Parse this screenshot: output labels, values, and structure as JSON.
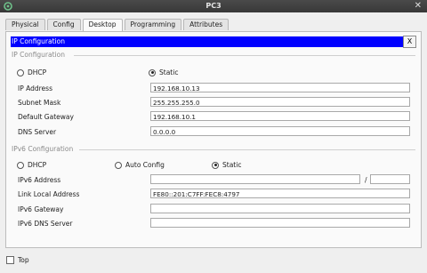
{
  "window": {
    "title": "PC3"
  },
  "tabs": [
    "Physical",
    "Config",
    "Desktop",
    "Programming",
    "Attributes"
  ],
  "active_tab": "Desktop",
  "ip_config": {
    "header": "IP Configuration",
    "close_label": "X",
    "section_label": "IP Configuration",
    "mode_options": {
      "dhcp": "DHCP",
      "static": "Static"
    },
    "selected_mode": "Static",
    "ip_address": {
      "label": "IP Address",
      "value": "192.168.10.13"
    },
    "subnet_mask": {
      "label": "Subnet Mask",
      "value": "255.255.255.0"
    },
    "default_gateway": {
      "label": "Default Gateway",
      "value": "192.168.10.1"
    },
    "dns_server": {
      "label": "DNS Server",
      "value": "0.0.0.0"
    }
  },
  "ipv6_config": {
    "section_label": "IPv6 Configuration",
    "mode_options": {
      "dhcp": "DHCP",
      "auto": "Auto Config",
      "static": "Static"
    },
    "selected_mode": "Static",
    "ipv6_address": {
      "label": "IPv6 Address",
      "value": "",
      "prefix": "",
      "separator": "/"
    },
    "link_local_address": {
      "label": "Link Local Address",
      "value": "FE80::201:C7FF:FEC8:4797"
    },
    "ipv6_gateway": {
      "label": "IPv6 Gateway",
      "value": ""
    },
    "ipv6_dns_server": {
      "label": "IPv6 DNS Server",
      "value": ""
    }
  },
  "footer": {
    "top_label": "Top",
    "top_checked": false
  }
}
